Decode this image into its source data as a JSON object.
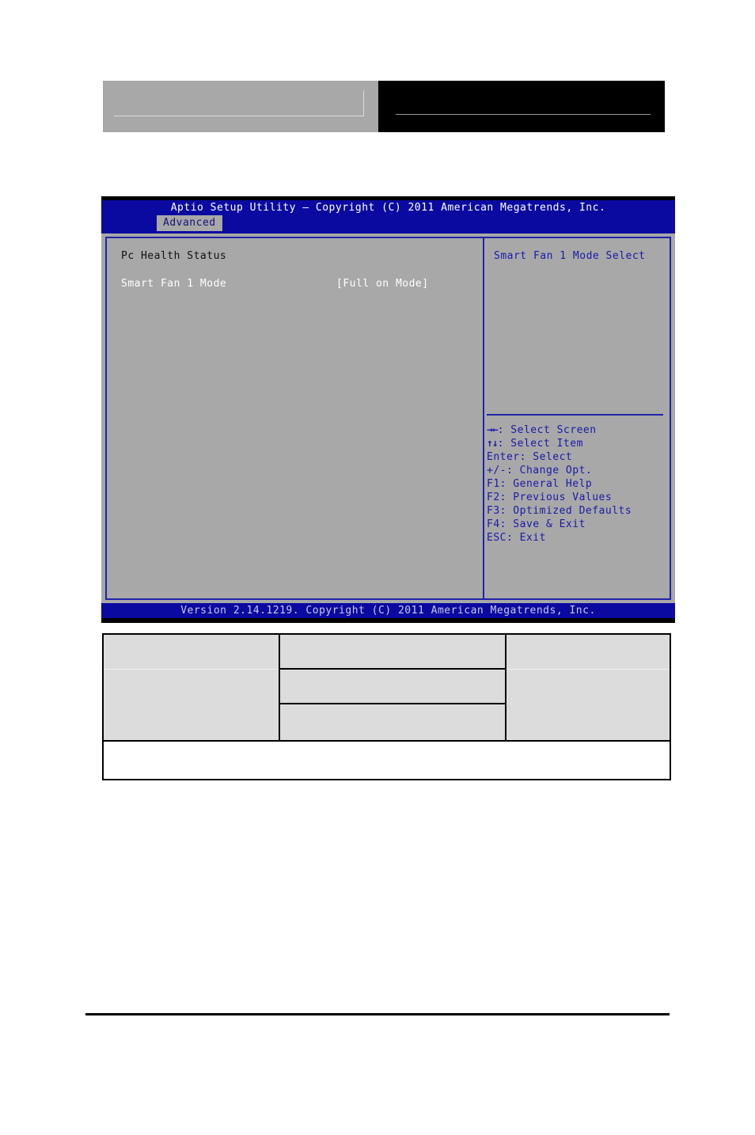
{
  "header": {
    "left_box": {
      "field_placeholder": ""
    },
    "right_box": {
      "field_placeholder": ""
    }
  },
  "bios": {
    "title": "Aptio Setup Utility – Copyright (C) 2011 American Megatrends, Inc.",
    "active_tab": "Advanced",
    "tabs": [
      "Advanced"
    ],
    "left_panel": {
      "section_title": "Pc Health Status",
      "settings": [
        {
          "label": "Smart Fan 1 Mode",
          "value": "[Full on Mode]"
        }
      ]
    },
    "right_panel": {
      "help_text": "Smart Fan 1 Mode Select",
      "key_legend": [
        {
          "keys": "→←",
          "action": ": Select Screen"
        },
        {
          "keys": "↑↓",
          "action": ": Select Item"
        },
        {
          "keys": "Enter",
          "action": ": Select"
        },
        {
          "keys": "+/-",
          "action": ": Change Opt."
        },
        {
          "keys": "F1",
          "action": ": General Help"
        },
        {
          "keys": "F2",
          "action": ": Previous Values"
        },
        {
          "keys": "F3",
          "action": ": Optimized Defaults"
        },
        {
          "keys": "F4",
          "action": ": Save & Exit"
        },
        {
          "keys": "ESC",
          "action": ": Exit"
        }
      ]
    },
    "version_bar": "Version 2.14.1219. Copyright (C) 2011 American Megatrends, Inc.",
    "colors": {
      "title_bar": "#0a0aa0",
      "panel_background": "#a8a8a8",
      "panel_border": "#2222aa",
      "help_text": "#1a1aa8",
      "setting_text": "#ffffff",
      "tab_background": "#a8a8a8",
      "tab_text": "#141478"
    }
  },
  "table": {
    "rows": [
      {
        "cells": [
          "",
          "",
          ""
        ]
      },
      {
        "cells": [
          "",
          "",
          ""
        ]
      },
      {
        "cells": [
          "",
          "",
          ""
        ]
      }
    ],
    "footer_row": {
      "text": ""
    }
  }
}
